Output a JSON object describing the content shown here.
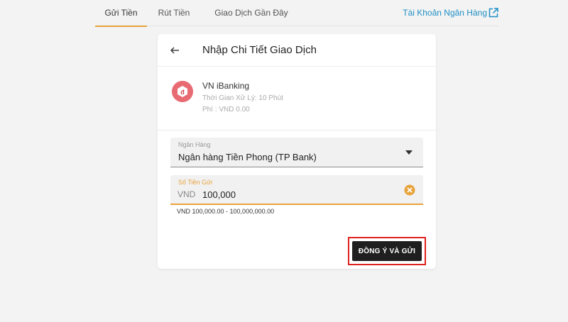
{
  "tabs": [
    {
      "label": "Gửi Tiền",
      "active": true
    },
    {
      "label": "Rút Tiền",
      "active": false
    },
    {
      "label": "Giao Dịch Gần Đây",
      "active": false
    }
  ],
  "bank_account_link": "Tài Khoản Ngân Hàng",
  "card": {
    "title": "Nhập Chi Tiết Giao Dịch",
    "method": {
      "name": "VN iBanking",
      "processing_time": "Thời Gian Xử Lý: 10 Phút",
      "fee": "Phí : VND 0.00"
    },
    "bank_field": {
      "label": "Ngân Hàng",
      "value": "Ngân hàng Tiền Phong (TP Bank)"
    },
    "amount_field": {
      "label": "Số Tiền Gửi",
      "currency": "VND",
      "value": "100,000"
    },
    "range_hint": "VND 100,000.00 - 100,000,000.00",
    "submit_label": "ĐỒNG Ý VÀ GỬI"
  },
  "colors": {
    "accent": "#e8a33c",
    "link": "#1e8fc4",
    "logo": "#e86a72",
    "highlight_border": "#e0201e"
  }
}
